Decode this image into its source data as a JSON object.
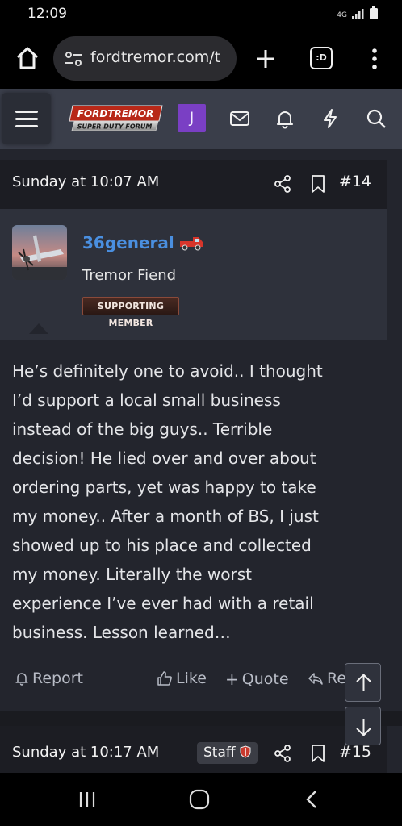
{
  "status": {
    "time": "12:09",
    "net": "4G"
  },
  "browser": {
    "url": "fordtremor.com/t",
    "tab_count": ":D"
  },
  "site": {
    "logo_main": "FORDTREMOR",
    "logo_sub": "SUPER DUTY FORUM",
    "user_initial": "J"
  },
  "post": {
    "date": "Sunday at 10:07 AM",
    "number": "#14",
    "author": {
      "name": "36general",
      "title": "Tremor Fiend",
      "badge": "SUPPORTING MEMBER"
    },
    "body": "He’s definitely one to avoid.. I thought\nI’d support a local small business\ninstead of the big guys.. Terrible\ndecision! He lied over and over about\nordering parts, yet was happy to take\nmy money.. After a month of BS, I just\nshowed up to his place and collected\nmy money. Literally the worst\nexperience I’ve ever had with a retail\nbusiness. Lesson learned…",
    "actions": {
      "report": "Report",
      "like": "Like",
      "quote": "Quote",
      "reply": "Reply"
    }
  },
  "next_post": {
    "date": "Sunday at 10:17 AM",
    "staff_label": "Staff",
    "number": "#15"
  },
  "colors": {
    "accent_purple": "#7a3fc4",
    "username_blue": "#4a8fe0",
    "header_bg": "#3a3e4a",
    "content_bg": "#23252d"
  }
}
